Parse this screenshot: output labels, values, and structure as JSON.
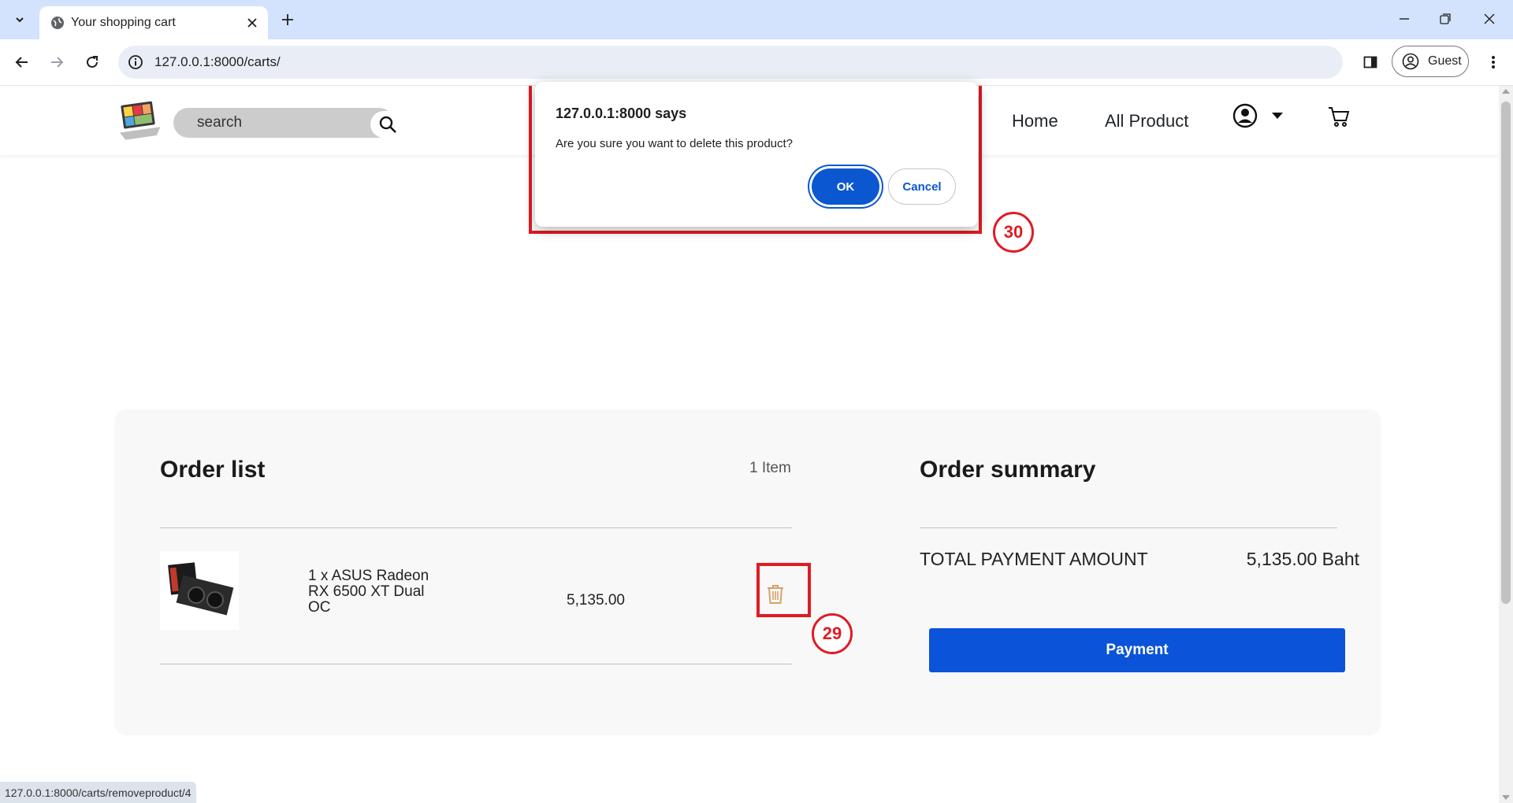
{
  "browser": {
    "tab_title": "Your shopping cart",
    "url": "127.0.0.1:8000/carts/",
    "profile_label": "Guest",
    "status_url": "127.0.0.1:8000/carts/removeproduct/4"
  },
  "site": {
    "search_placeholder": "search",
    "nav": {
      "home": "Home",
      "all_product": "All Product"
    }
  },
  "order_list": {
    "title": "Order list",
    "item_count": "1 Item",
    "items": [
      {
        "name": "1 x ASUS Radeon RX 6500 XT Dual OC",
        "price": "5,135.00"
      }
    ]
  },
  "order_summary": {
    "title": "Order summary",
    "total_label": "TOTAL PAYMENT AMOUNT",
    "total_value": "5,135.00 Baht",
    "payment_button": "Payment"
  },
  "dialog": {
    "title": "127.0.0.1:8000 says",
    "message": "Are you sure you want to delete this product?",
    "ok_label": "OK",
    "cancel_label": "Cancel"
  },
  "annotations": {
    "trash_step": "29",
    "dialog_step": "30"
  },
  "colors": {
    "primary": "#0b53d9",
    "annotation": "#e01b24",
    "trash_icon": "#d8a36a",
    "tab_strip": "#d3e3fd"
  }
}
